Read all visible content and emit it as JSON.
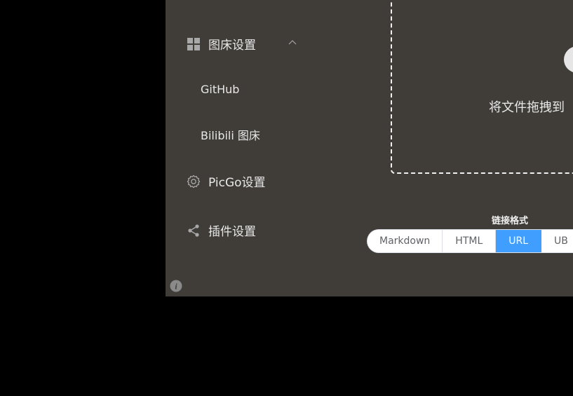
{
  "sidebar": {
    "image_host_settings": {
      "label": "图床设置",
      "icon": "grid-icon",
      "expanded": true
    },
    "sub_items": [
      {
        "label": "GitHub"
      },
      {
        "label": "Bilibili 图床"
      }
    ],
    "picgo_settings": {
      "label": "PicGo设置",
      "icon": "gear-icon"
    },
    "plugin_settings": {
      "label": "插件设置",
      "icon": "share-icon"
    },
    "info_icon": "info-icon"
  },
  "upload": {
    "drop_text": "将文件拖拽到"
  },
  "link_format": {
    "label": "链接格式",
    "options": [
      {
        "label": "Markdown",
        "active": false
      },
      {
        "label": "HTML",
        "active": false
      },
      {
        "label": "URL",
        "active": true
      },
      {
        "label": "UB",
        "active": false
      }
    ]
  },
  "colors": {
    "background": "#403d39",
    "accent": "#409eff",
    "text": "#e8e8e8"
  }
}
